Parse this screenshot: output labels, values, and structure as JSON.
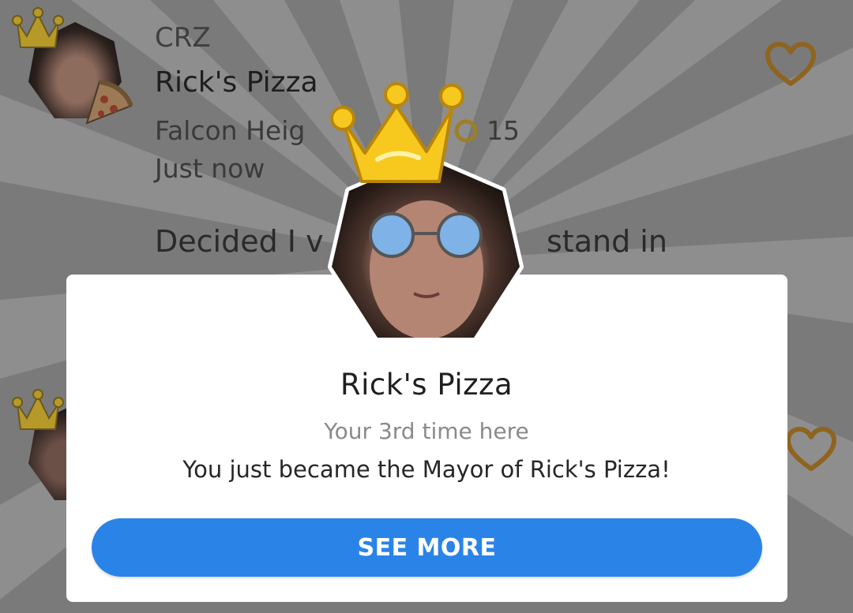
{
  "background": {
    "dim_color": "#7d7d7d"
  },
  "feed": {
    "item1": {
      "username": "CRZ",
      "venue": "Rick's Pizza",
      "location": "Falcon Heig",
      "coins": "15",
      "time": "Just now",
      "text": "Decided I v",
      "text_tail": "stand in"
    }
  },
  "modal": {
    "title": "Rick's Pizza",
    "subtitle": "Your 3rd time here",
    "message": "You just became the Mayor of Rick's Pizza!",
    "button_label": "SEE MORE"
  },
  "colors": {
    "accent_blue": "#2a84e8",
    "heart_orange": "#c98a2d",
    "crown_yellow": "#f7c81e"
  },
  "icons": [
    "crown-icon",
    "pizza-slice-icon",
    "heart-icon",
    "coin-icon"
  ]
}
